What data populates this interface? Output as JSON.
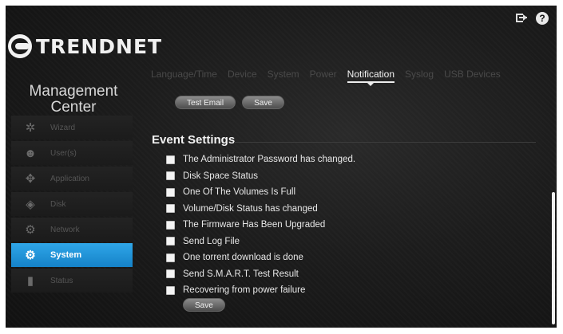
{
  "brand": {
    "name": "TRENDNET"
  },
  "title_block": {
    "line1": "Management",
    "line2": "Center"
  },
  "header_icons": [
    "logout-icon",
    "help-icon"
  ],
  "help_glyph": "?",
  "sidebar": {
    "items": [
      {
        "label": "Wizard",
        "icon": "wand-icon",
        "glyph": "✲",
        "active": false
      },
      {
        "label": "User(s)",
        "icon": "users-icon",
        "glyph": "☻",
        "active": false
      },
      {
        "label": "Application",
        "icon": "puzzle-icon",
        "glyph": "✥",
        "active": false
      },
      {
        "label": "Disk",
        "icon": "disk-icon",
        "glyph": "◈",
        "active": false
      },
      {
        "label": "Network",
        "icon": "network-icon",
        "glyph": "⚙",
        "active": false
      },
      {
        "label": "System",
        "icon": "gears-icon",
        "glyph": "⚙",
        "active": true
      },
      {
        "label": "Status",
        "icon": "bar-chart-icon",
        "glyph": "▮",
        "active": false
      }
    ]
  },
  "tabs": [
    {
      "label": "Language/Time",
      "active": false
    },
    {
      "label": "Device",
      "active": false
    },
    {
      "label": "System",
      "active": false
    },
    {
      "label": "Power",
      "active": false
    },
    {
      "label": "Notification",
      "active": true
    },
    {
      "label": "Syslog",
      "active": false
    },
    {
      "label": "USB Devices",
      "active": false
    }
  ],
  "buttons": {
    "test_email": "Test Email",
    "save_top": "Save",
    "save_bottom": "Save"
  },
  "section": {
    "title": "Event Settings"
  },
  "events": [
    {
      "label": "The Administrator Password has changed.",
      "checked": false
    },
    {
      "label": "Disk Space Status",
      "checked": false
    },
    {
      "label": "One Of The Volumes Is Full",
      "checked": false
    },
    {
      "label": "Volume/Disk Status has changed",
      "checked": false
    },
    {
      "label": "The Firmware Has Been Upgraded",
      "checked": false
    },
    {
      "label": "Send Log File",
      "checked": false
    },
    {
      "label": "One torrent download is done",
      "checked": false
    },
    {
      "label": "Send S.M.A.R.T. Test Result",
      "checked": false
    },
    {
      "label": "Recovering from power failure",
      "checked": false
    }
  ],
  "colors": {
    "accent": "#1f93d8",
    "background": "#1c1c1c",
    "text": "#e8e8e8"
  }
}
